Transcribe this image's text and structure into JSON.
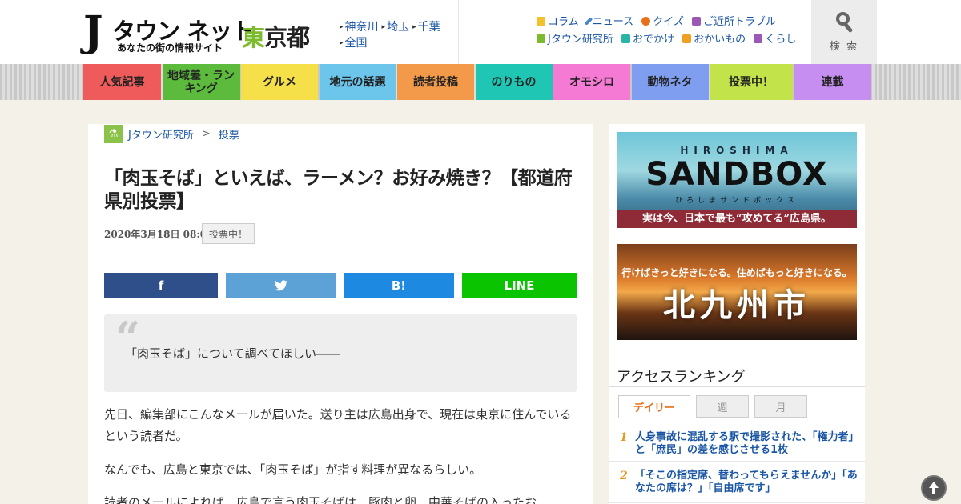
{
  "header": {
    "logo_main": "タウン ネット",
    "logo_j": "J",
    "logo_sub": "あなたの街の情報サイト",
    "prefecture_accent": "東",
    "prefecture_rest": "京都",
    "regions": [
      "神奈川",
      "埼玉",
      "千葉",
      "全国"
    ],
    "categories": [
      {
        "label": "コラム",
        "icon": "note-icon",
        "color": "#f2c12e"
      },
      {
        "label": "ニュース",
        "icon": "pencil-icon",
        "color": "#4a86c7"
      },
      {
        "label": "クイズ",
        "icon": "quiz-icon",
        "color": "#e8701a"
      },
      {
        "label": "ご近所トラブル",
        "icon": "house-icon",
        "color": "#9b59b6"
      },
      {
        "label": "Jタウン研究所",
        "icon": "flask-icon",
        "color": "#7dbb2e"
      },
      {
        "label": "おでかけ",
        "icon": "car-icon",
        "color": "#2bb3a5"
      },
      {
        "label": "おかいもの",
        "icon": "bag-icon",
        "color": "#f0a020"
      },
      {
        "label": "くらし",
        "icon": "house-icon",
        "color": "#9b59b6"
      }
    ],
    "search_label": "検 索"
  },
  "nav": [
    {
      "label": "人気記事",
      "color": "#ef5a5a"
    },
    {
      "label": "地域差・ランキング",
      "color": "#5cba3c"
    },
    {
      "label": "グルメ",
      "color": "#f5e04a"
    },
    {
      "label": "地元の話題",
      "color": "#6cc6ec"
    },
    {
      "label": "読者投稿",
      "color": "#f39a4a"
    },
    {
      "label": "のりもの",
      "color": "#1fc6b4"
    },
    {
      "label": "オモシロ",
      "color": "#f47ad4"
    },
    {
      "label": "動物ネタ",
      "color": "#7f9ef0"
    },
    {
      "label": "投票中！",
      "color": "#c3e34a"
    },
    {
      "label": "連載",
      "color": "#c68ef0"
    }
  ],
  "article": {
    "breadcrumb": [
      "Jタウン研究所",
      "投票"
    ],
    "breadcrumb_sep": ">",
    "title": "「肉玉そば」といえば、ラーメン？お好み焼き？【都道府県別投票】",
    "date": "2020年3月18日 08:00",
    "badge": "投票中！",
    "share": {
      "facebook": "f",
      "twitter": "twitter",
      "hatena": "B!",
      "line": "LINE"
    },
    "quote": "「肉玉そば」について調べてほしい――",
    "paragraphs": [
      "先日、編集部にこんなメールが届いた。送り主は広島出身で、現在は東京に住んでいるという読者だ。",
      "なんでも、広島と東京では、「肉玉そば」が指す料理が異なるらしい。",
      "読者のメールによれば、広島で言う肉玉そばは、豚肉と卵、中華そばの入ったお"
    ]
  },
  "sidebar": {
    "banner1": {
      "top": "HIROSHIMA",
      "main": "SANDBOX",
      "kana": "ひろしまサンドボックス",
      "foot": "実は今、日本で最も“攻めてる”広島県。"
    },
    "banner2": {
      "top": "行けばきっと好きになる。住めばもっと好きになる。",
      "main": "北九州市"
    },
    "ranking_title": "アクセスランキング",
    "tabs": [
      "デイリー",
      "週",
      "月"
    ],
    "ranking": [
      {
        "num": "1",
        "text": "人身事故に混乱する駅で撮影された、「権力者」と「庶民」の差を感じさせる1枚"
      },
      {
        "num": "2",
        "text": "「そこの指定席、替わってもらえませんか」「あなたの席は？」「自由席です」"
      }
    ]
  }
}
